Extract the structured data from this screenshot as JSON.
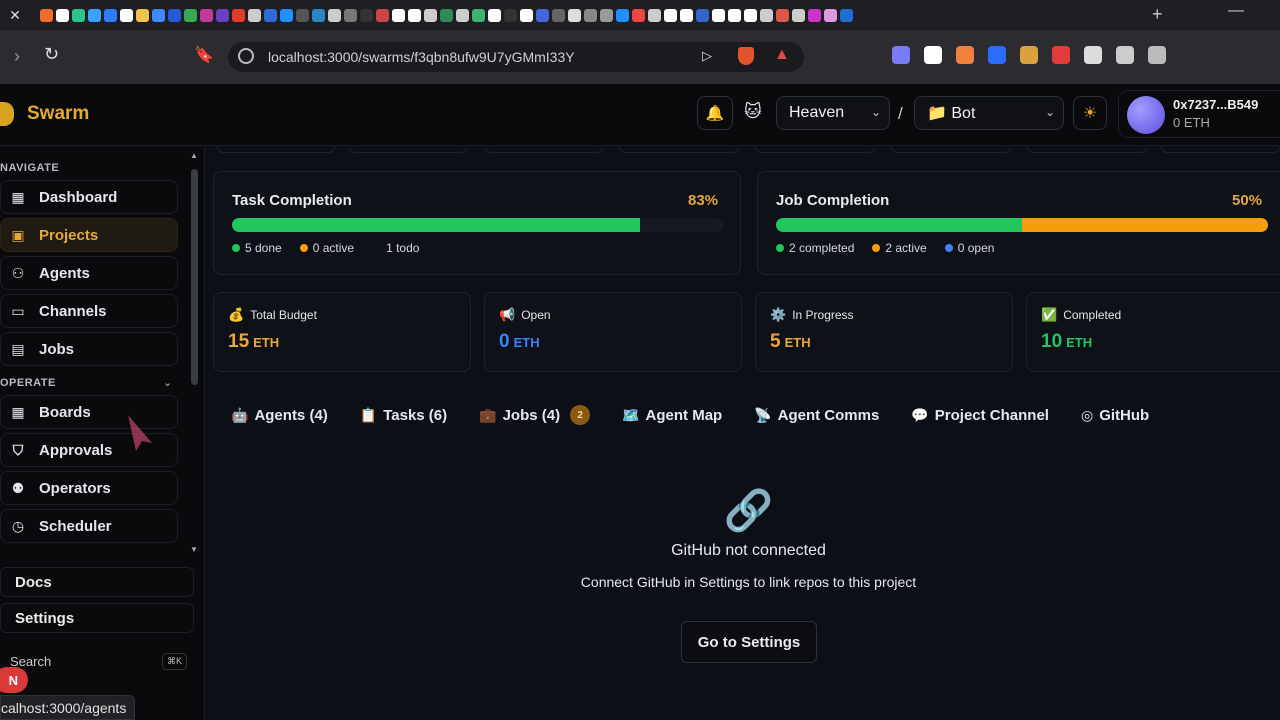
{
  "browser": {
    "url": "localhost:3000/swarms/f3qbn8ufw9U7yGMmI33Y",
    "status_url": "calhost:3000/agents",
    "favicon_colors": [
      "#f26b2b",
      "#fff",
      "#2bc48a",
      "#3aa2ff",
      "#2b7cff",
      "#fff",
      "#f3c24c",
      "#3b8bff",
      "#2659d6",
      "#35a853",
      "#c23b9c",
      "#6a3fc1",
      "#e33b2b",
      "#ccc",
      "#2b6cd6",
      "#1e90ff",
      "#555",
      "#2b86c5",
      "#ccc",
      "#777",
      "#333",
      "#c44",
      "#fff",
      "#fff",
      "#ccc",
      "#2e8b57",
      "#ccc",
      "#3cb371",
      "#fff",
      "#333",
      "#fff",
      "#4466dd",
      "#666",
      "#ddd",
      "#888",
      "#999",
      "#1e90ff",
      "#e44",
      "#ccc",
      "#fff",
      "#fff",
      "#36c",
      "#fff",
      "#fff",
      "#fff",
      "#ccc",
      "#d54",
      "#ccc",
      "#c3c",
      "#d9d",
      "#1e6cd6"
    ],
    "extension_colors": [
      "#7a7cf5",
      "#ffffff",
      "#f0803c",
      "#2b6cff",
      "#d9a23c",
      "#e33b3b",
      "#dddddd",
      "#cccccc",
      "#bbbbbb"
    ]
  },
  "header": {
    "logo_text": "Swarm",
    "workspace_select": "Heaven",
    "separator": "/",
    "project_select": "📁 Bot",
    "wallet_address": "0x7237...B549",
    "wallet_balance": "0 ETH",
    "accent": "#e2ac2c"
  },
  "sidebar": {
    "navigate_label": "NAVIGATE",
    "operate_label": "OPERATE",
    "navigate_items": [
      {
        "label": "Dashboard",
        "icon": "grid-icon"
      },
      {
        "label": "Projects",
        "icon": "folder-icon",
        "active": true
      },
      {
        "label": "Agents",
        "icon": "users-icon"
      },
      {
        "label": "Channels",
        "icon": "message-icon"
      },
      {
        "label": "Jobs",
        "icon": "briefcase-icon"
      }
    ],
    "operate_items": [
      {
        "label": "Boards",
        "icon": "grid-icon"
      },
      {
        "label": "Approvals",
        "icon": "shield-icon"
      },
      {
        "label": "Operators",
        "icon": "user-cog-icon"
      },
      {
        "label": "Scheduler",
        "icon": "clock-icon"
      }
    ],
    "bottom_items": [
      {
        "label": "Docs"
      },
      {
        "label": "Settings"
      }
    ],
    "search_label": "Search",
    "search_kbd": "⌘K",
    "notification_badge": "N"
  },
  "task_completion": {
    "title": "Task Completion",
    "percent": "83%",
    "fill": 0.83,
    "legend": [
      {
        "label": "5 done",
        "color": "#22c55e"
      },
      {
        "label": "0 active",
        "color": "#f59e0b"
      },
      {
        "label": "1 todo",
        "color": ""
      }
    ]
  },
  "job_completion": {
    "title": "Job Completion",
    "percent": "50%",
    "completed_fraction": 0.5,
    "active_fraction": 0.5,
    "legend": [
      {
        "label": "2 completed",
        "color": "#22c55e"
      },
      {
        "label": "2 active",
        "color": "#f59e0b"
      },
      {
        "label": "0 open",
        "color": "#3b82f6"
      }
    ]
  },
  "stats": [
    {
      "emoji": "💰",
      "title": "Total Budget",
      "value": "15",
      "unit": "ETH",
      "color": "#f0a53a"
    },
    {
      "emoji": "📢",
      "title": "Open",
      "value": "0",
      "unit": "ETH",
      "color": "#3b82f6"
    },
    {
      "emoji": "⚙️",
      "title": "In Progress",
      "value": "5",
      "unit": "ETH",
      "color": "#f0a53a"
    },
    {
      "emoji": "✅",
      "title": "Completed",
      "value": "10",
      "unit": "ETH",
      "color": "#22c55e"
    }
  ],
  "tabs": [
    {
      "emoji": "🤖",
      "label": "Agents (4)"
    },
    {
      "emoji": "📋",
      "label": "Tasks (6)"
    },
    {
      "emoji": "💼",
      "label": "Jobs (4)",
      "badge": "2"
    },
    {
      "emoji": "🗺️",
      "label": "Agent Map"
    },
    {
      "emoji": "📡",
      "label": "Agent Comms"
    },
    {
      "emoji": "💬",
      "label": "Project Channel"
    },
    {
      "emoji": "github-icon",
      "label": "GitHub"
    }
  ],
  "empty_state": {
    "icon": "link-icon",
    "headline": "GitHub not connected",
    "description": "Connect GitHub in Settings to link repos to this project",
    "button": "Go to Settings"
  }
}
